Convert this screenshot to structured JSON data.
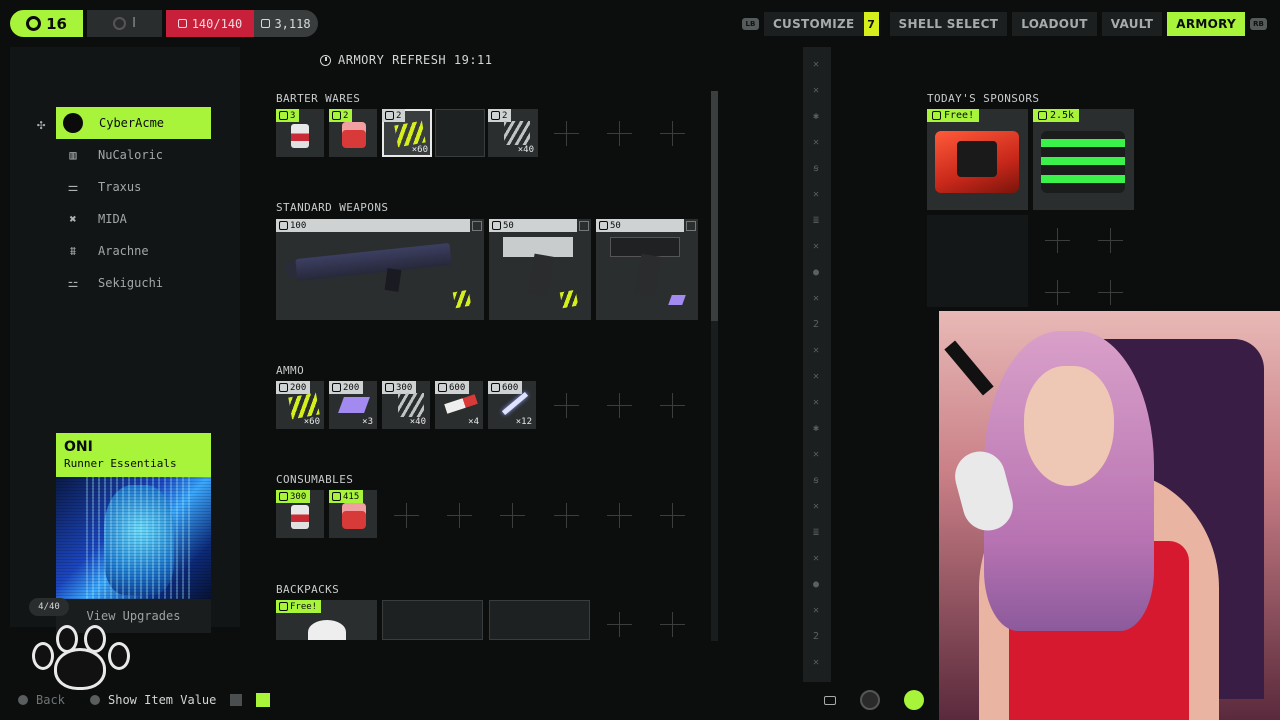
{
  "topbar": {
    "level": "16",
    "rank_label": "I",
    "health": "140/140",
    "currency": "3,118"
  },
  "nav": {
    "lb": "LB",
    "rb": "RB",
    "customize": "CUSTOMIZE",
    "customize_badge": "7",
    "shell_select": "SHELL SELECT",
    "loadout": "LOADOUT",
    "vault": "VAULT",
    "armory": "ARMORY"
  },
  "refresh_label": "ARMORY REFRESH 19:11",
  "corporations": [
    {
      "name": "CyberAcme",
      "icon": "cyberacme-logo-icon"
    },
    {
      "name": "NuCaloric",
      "icon": "nucaloric-logo-icon"
    },
    {
      "name": "Traxus",
      "icon": "traxus-logo-icon"
    },
    {
      "name": "MIDA",
      "icon": "mida-logo-icon"
    },
    {
      "name": "Arachne",
      "icon": "arachne-logo-icon"
    },
    {
      "name": "Sekiguchi",
      "icon": "sekiguchi-logo-icon"
    }
  ],
  "promo": {
    "title": "ONI",
    "subtitle": "Runner Essentials",
    "footer": "View Upgrades"
  },
  "page_pill": "4/40",
  "sections": {
    "barter": "BARTER WARES",
    "weapons": "STANDARD WEAPONS",
    "ammo": "AMMO",
    "consumables": "CONSUMABLES",
    "backpacks": "BACKPACKS"
  },
  "barter": [
    {
      "cost": "3",
      "qty": ""
    },
    {
      "cost": "2",
      "qty": ""
    },
    {
      "cost": "2",
      "qty": "×60"
    },
    {
      "cost": "",
      "qty": ""
    },
    {
      "cost": "2",
      "qty": "×40"
    }
  ],
  "weapons": [
    {
      "price": "100"
    },
    {
      "price": "50"
    },
    {
      "price": "50"
    }
  ],
  "ammo": [
    {
      "price": "200",
      "qty": "×60"
    },
    {
      "price": "200",
      "qty": "×3"
    },
    {
      "price": "300",
      "qty": "×40"
    },
    {
      "price": "600",
      "qty": "×4"
    },
    {
      "price": "600",
      "qty": "×12"
    }
  ],
  "consumables": [
    {
      "price": "300"
    },
    {
      "price": "415"
    }
  ],
  "backpacks": [
    {
      "price": "Free!"
    }
  ],
  "sponsors": {
    "title": "TODAY'S SPONSORS",
    "items": [
      {
        "price": "Free!"
      },
      {
        "price": "2.5k"
      }
    ]
  },
  "bottom": {
    "back": "Back",
    "show_value": "Show Item Value"
  },
  "colors": {
    "accent": "#a7f43a",
    "health": "#c8203a",
    "background": "#0c0e0e"
  }
}
